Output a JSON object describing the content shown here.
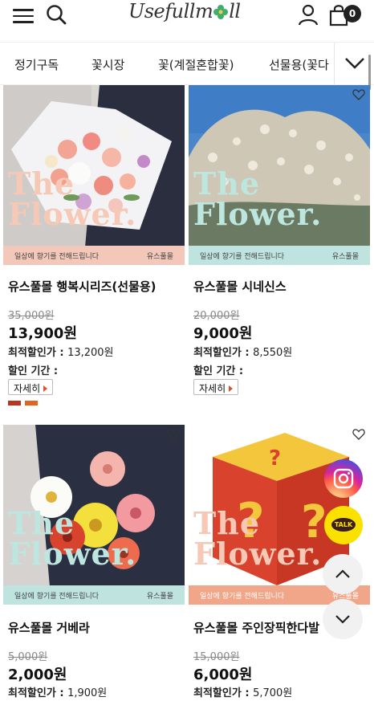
{
  "header": {
    "logo_text_a": "Usefullm",
    "logo_text_b": "ll",
    "cart_count": "0"
  },
  "categories": [
    "정기구독",
    "꽃시장",
    "꽃(계절혼합꽃)",
    "선물용(꽃다"
  ],
  "card_overlay": {
    "word1": "The",
    "word2": "Flower.",
    "caption_left": "일상에 향기를 전해드립니다",
    "caption_right": "유스풀몰"
  },
  "labels": {
    "best_price": "최적할인가 : ",
    "period": "할인 기간 :",
    "detail": "자세히"
  },
  "products": [
    {
      "name": "유스풀몰 행복시리즈(선물용)",
      "original_price": "35,000원",
      "sale_price": "13,900원",
      "best_price": "13,200원",
      "color_swatches": [
        "#b8351f",
        "#e2641f"
      ]
    },
    {
      "name": "유스풀몰 시네신스",
      "original_price": "20,000원",
      "sale_price": "9,000원",
      "best_price": "8,550원"
    },
    {
      "name": "유스풀몰 거베라",
      "original_price": "5,000원",
      "sale_price": "2,000원",
      "best_price": "1,900원"
    },
    {
      "name": "유스풀몰 주인장픽한다발",
      "original_price": "15,000원",
      "sale_price": "6,000원",
      "best_price": "5,700원"
    }
  ],
  "floating": {
    "talk_label": "TALK"
  },
  "colors": {
    "overlay_pink": "#f3c7b9",
    "overlay_teal": "#bfe3df",
    "word_pink": "#f5c9b6",
    "word_teal": "#bde6df",
    "accent_red": "#e0502a"
  }
}
